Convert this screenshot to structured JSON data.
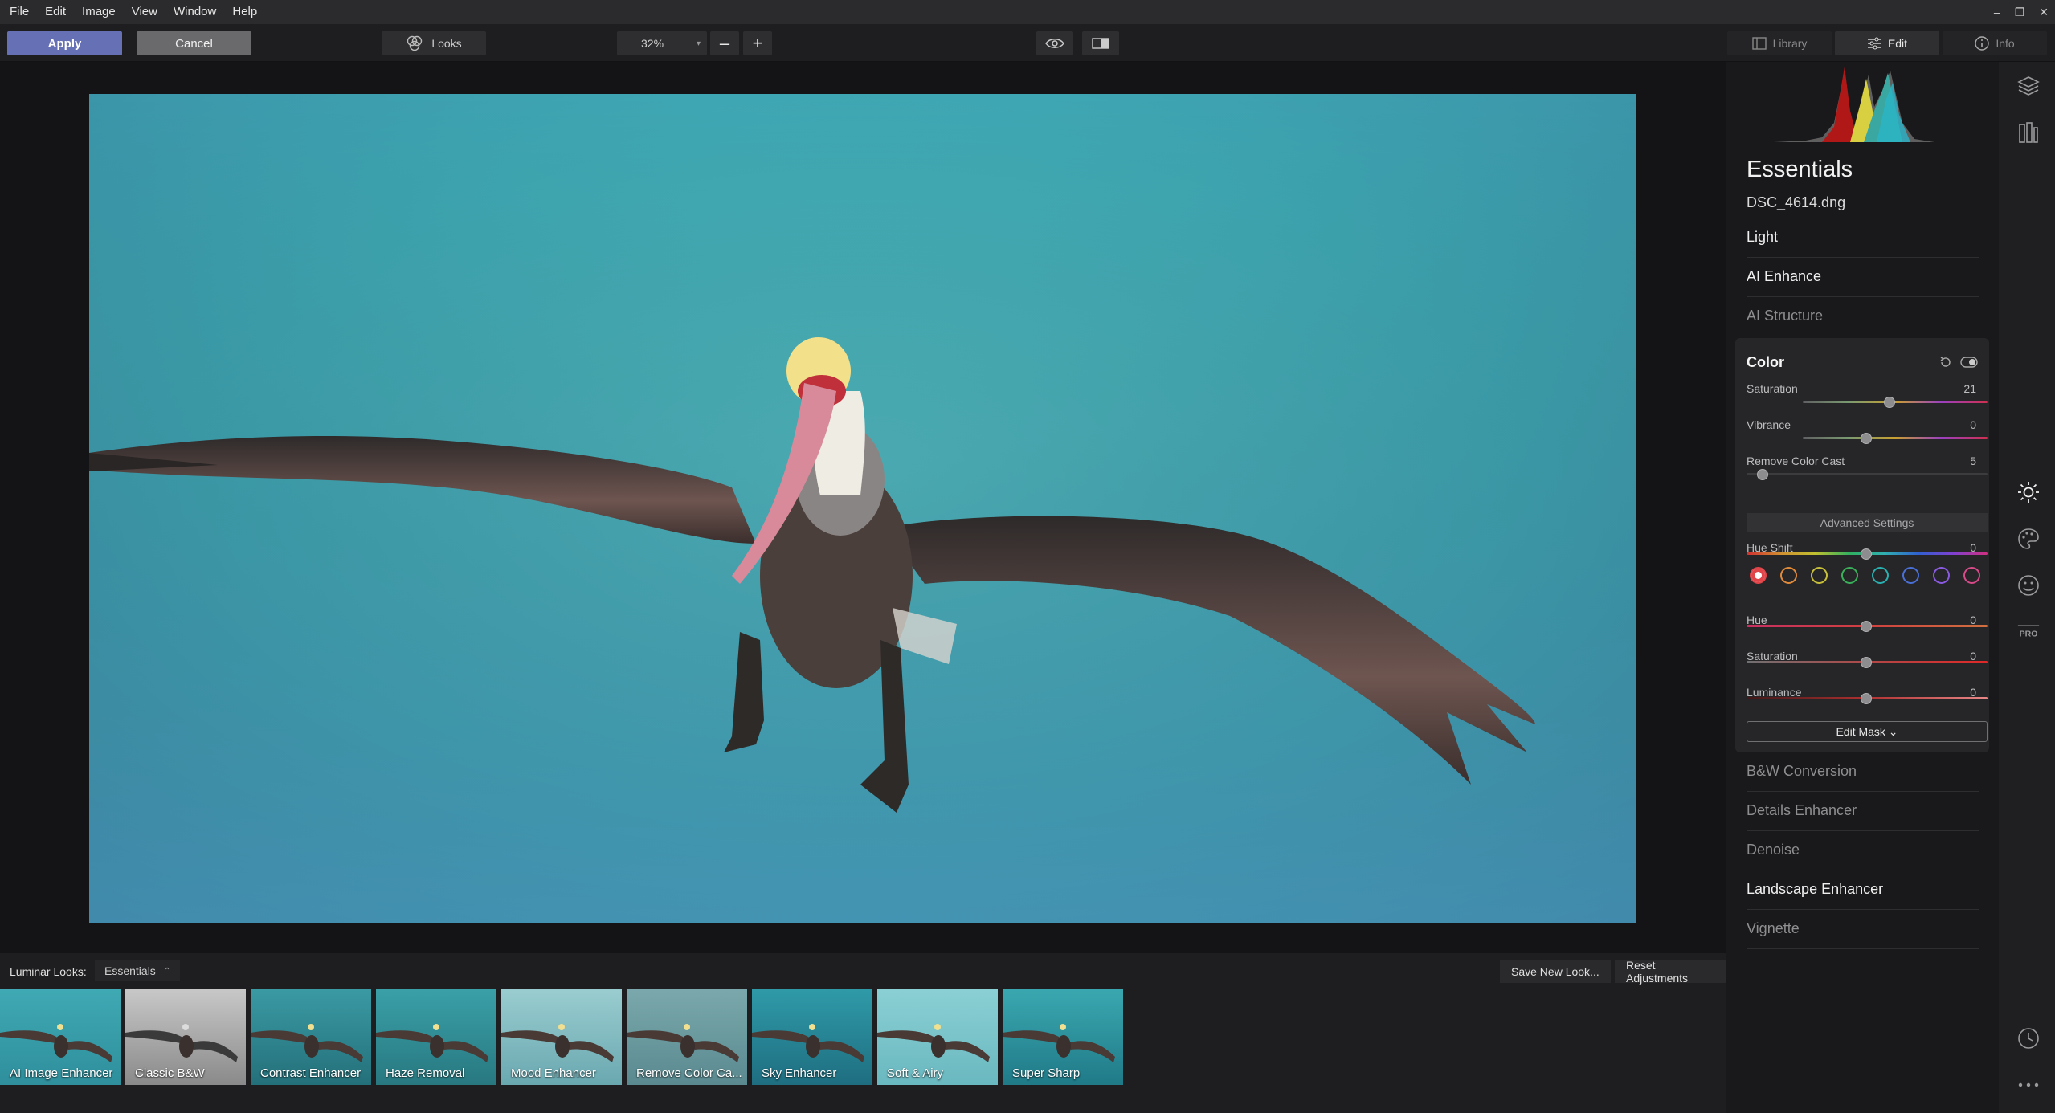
{
  "menu": [
    "File",
    "Edit",
    "Image",
    "View",
    "Window",
    "Help"
  ],
  "toolbar": {
    "apply_label": "Apply",
    "cancel_label": "Cancel",
    "looks_label": "Looks",
    "zoom_value": "32%"
  },
  "tabs": [
    {
      "label": "Library",
      "active": false
    },
    {
      "label": "Edit",
      "active": true
    },
    {
      "label": "Info",
      "active": false
    }
  ],
  "panel": {
    "title": "Essentials",
    "file_name": "DSC_4614.dng",
    "sections_top": [
      "Light",
      "AI Enhance",
      "AI Structure"
    ],
    "sections_bottom": [
      "B&W Conversion",
      "Details Enhancer",
      "Denoise",
      "Landscape Enhancer",
      "Vignette"
    ]
  },
  "color": {
    "title": "Color",
    "saturation": {
      "label": "Saturation",
      "value": "21"
    },
    "vibrance": {
      "label": "Vibrance",
      "value": "0"
    },
    "remove_cast": {
      "label": "Remove Color Cast",
      "value": "5"
    },
    "advanced_label": "Advanced Settings",
    "hue_shift": {
      "label": "Hue Shift",
      "value": "0"
    },
    "swatch_colors": [
      "#e0454a",
      "#e08a3a",
      "#c8c03a",
      "#3ab05a",
      "#2ab0b0",
      "#4a70d8",
      "#8a5ae0",
      "#d84a8a"
    ],
    "hue": {
      "label": "Hue",
      "value": "0"
    },
    "sat2": {
      "label": "Saturation",
      "value": "0"
    },
    "luminance": {
      "label": "Luminance",
      "value": "0"
    },
    "edit_mask_label": "Edit Mask ⌄"
  },
  "looks": {
    "label": "Luminar Looks:",
    "category": "Essentials",
    "save_label": "Save New Look...",
    "reset_label": "Reset Adjustments",
    "items": [
      "AI Image Enhancer",
      "Classic B&W",
      "Contrast Enhancer",
      "Haze Removal",
      "Mood Enhancer",
      "Remove Color Ca...",
      "Sky Enhancer",
      "Soft & Airy",
      "Super Sharp"
    ]
  },
  "colors": {
    "apply_button": "#6670b5",
    "water_light": "#4fb8bf",
    "water_dark": "#2f8f9c"
  }
}
